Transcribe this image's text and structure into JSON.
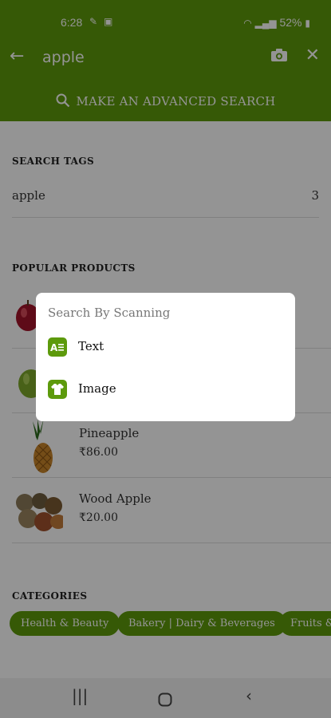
{
  "status_bar": {
    "time": "6:28",
    "battery": "52%"
  },
  "header": {
    "query": "apple",
    "advanced_search": "MAKE AN ADVANCED SEARCH"
  },
  "search_tags": {
    "title": "SEARCH TAGS",
    "items": [
      {
        "label": "apple",
        "count": "3"
      }
    ]
  },
  "popular_products": {
    "title": "POPULAR PRODUCTS",
    "items": [
      {
        "name": "",
        "price": ""
      },
      {
        "name": "",
        "price": ""
      },
      {
        "name": "Pineapple",
        "price": "₹86.00"
      },
      {
        "name": "Wood Apple",
        "price": "₹20.00"
      }
    ]
  },
  "categories": {
    "title": "CATEGORIES",
    "items": [
      "Health & Beauty",
      "Bakery | Dairy & Beverages",
      "Fruits &"
    ]
  },
  "dialog": {
    "title": "Search By Scanning",
    "options": [
      {
        "label": "Text",
        "icon": "text-scan-icon"
      },
      {
        "label": "Image",
        "icon": "shirt-icon"
      }
    ]
  },
  "colors": {
    "accent": "#5d9a0c",
    "scrim": "rgba(0,0,0,0.42)"
  }
}
